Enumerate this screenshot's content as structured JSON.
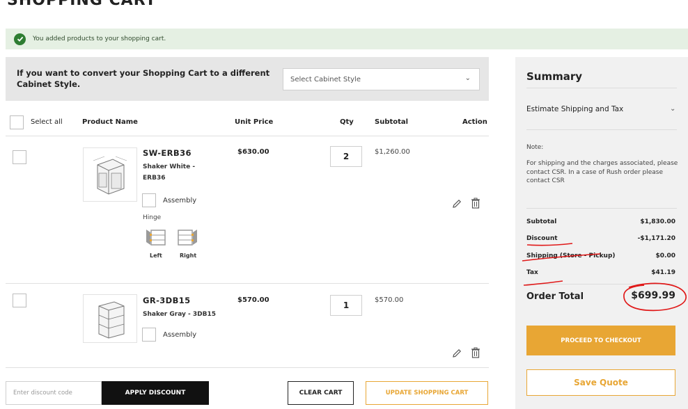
{
  "page": {
    "title": "SHOPPING CART"
  },
  "notice": {
    "text": "You added products to your shopping cart."
  },
  "convert": {
    "message": "If you want to convert your Shopping Cart to a different Cabinet Style.",
    "select_value": "Select Cabinet Style"
  },
  "table": {
    "select_all": "Select all",
    "headers": {
      "product": "Product Name",
      "unit_price": "Unit Price",
      "qty": "Qty",
      "subtotal": "Subtotal",
      "action": "Action"
    }
  },
  "items": [
    {
      "sku": "SW-ERB36",
      "name": "Shaker White - ERB36",
      "unit_price": "$630.00",
      "qty": "2",
      "subtotal": "$1,260.00",
      "assembly_label": "Assembly",
      "hinge_label": "Hinge",
      "hinge_left": "Left",
      "hinge_right": "Right"
    },
    {
      "sku": "GR-3DB15",
      "name": "Shaker Gray - 3DB15",
      "unit_price": "$570.00",
      "qty": "1",
      "subtotal": "$570.00",
      "assembly_label": "Assembly"
    }
  ],
  "bottom": {
    "discount_placeholder": "Enter discount code",
    "apply_discount": "APPLY DISCOUNT",
    "clear_cart": "CLEAR CART",
    "update_cart": "UPDATE SHOPPING CART"
  },
  "summary": {
    "title": "Summary",
    "estimate": "Estimate Shipping and Tax",
    "note_heading": "Note:",
    "note_text": "For shipping and the charges associated, please contact CSR. In a case of Rush order please contact CSR",
    "rows": [
      {
        "label": "Subtotal",
        "value": "$1,830.00"
      },
      {
        "label": "Discount",
        "value": "-$1,171.20"
      },
      {
        "label": "Shipping (Store - Pickup)",
        "value": "$0.00"
      },
      {
        "label": "Tax",
        "value": "$41.19"
      }
    ],
    "order_total_label": "Order Total",
    "order_total_value": "$699.99",
    "checkout": "PROCEED TO CHECKOUT",
    "save_quote": "Save Quote"
  },
  "colors": {
    "accent": "#e8a634",
    "success_bg": "#e5f0e3",
    "success_icon": "#2e7d32",
    "annotation": "#e01818"
  }
}
